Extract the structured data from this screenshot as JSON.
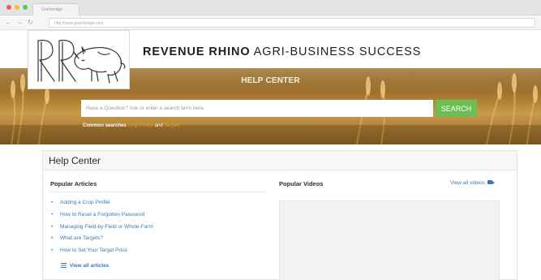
{
  "browser": {
    "tab_label": "Grainbridge",
    "url": "http://www.grainbridge.com"
  },
  "site": {
    "brand_bold": "REVENUE RHINO",
    "brand_rest": " AGRI-BUSINESS SUCCESS"
  },
  "hero": {
    "title": "HELP CENTER",
    "search_placeholder": "Have a Question? Ask or enter a search term here.",
    "search_button": "SEARCH",
    "common_label": "Common searches",
    "common_links": [
      "Crop Profile",
      "Targets"
    ],
    "common_joiner": " and "
  },
  "help_center": {
    "title": "Help Center",
    "popular_articles": {
      "heading": "Popular Articles",
      "items": [
        "Adding a Crop Profile",
        "How to Reset a Forgotten Password",
        "Managing Field-by-Field or Whole-Farm",
        "What are Targets?",
        "How to Set Your Target Price"
      ],
      "view_all": "View all articles"
    },
    "popular_videos": {
      "heading": "Popular Videos",
      "view_all": "View all videos"
    }
  },
  "colors": {
    "link": "#3b78b8",
    "search_button": "#6cbd54",
    "accent_link": "#e8a03a"
  }
}
